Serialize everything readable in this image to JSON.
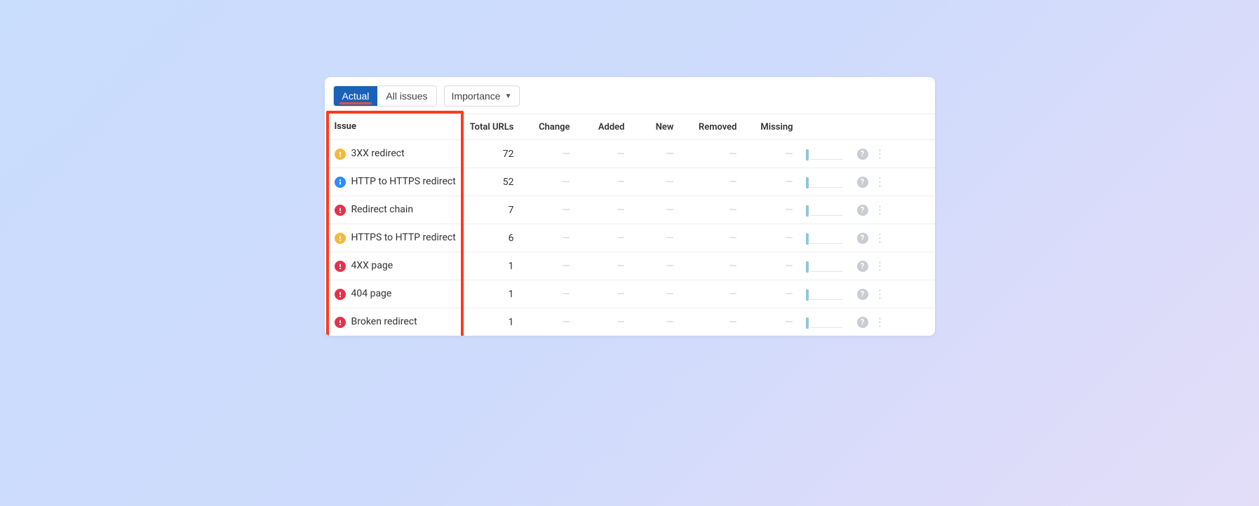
{
  "toolbar": {
    "tab_actual": "Actual",
    "tab_all": "All issues",
    "dropdown_importance": "Importance"
  },
  "columns": {
    "issue": "Issue",
    "total_urls": "Total URLs",
    "change": "Change",
    "added": "Added",
    "new": "New",
    "removed": "Removed",
    "missing": "Missing"
  },
  "dash": "—",
  "help_glyph": "?",
  "menu_glyph": "⋮",
  "rows": [
    {
      "severity": "warning",
      "label": "3XX redirect",
      "total": "72"
    },
    {
      "severity": "info",
      "label": "HTTP to HTTPS redirect",
      "total": "52"
    },
    {
      "severity": "error",
      "label": "Redirect chain",
      "total": "7"
    },
    {
      "severity": "warning",
      "label": "HTTPS to HTTP redirect",
      "total": "6"
    },
    {
      "severity": "error",
      "label": "4XX page",
      "total": "1"
    },
    {
      "severity": "error",
      "label": "404 page",
      "total": "1"
    },
    {
      "severity": "error",
      "label": "Broken redirect",
      "total": "1"
    }
  ]
}
